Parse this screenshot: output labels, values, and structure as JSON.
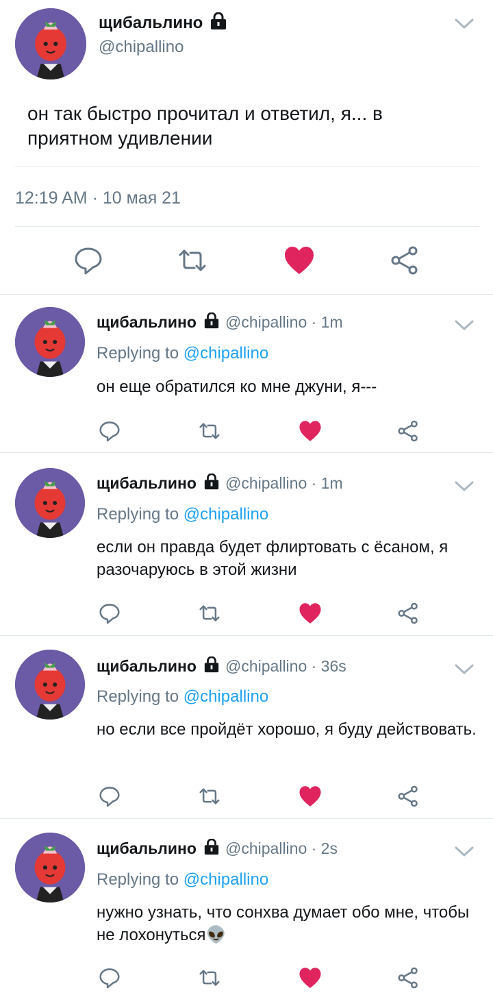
{
  "main_tweet": {
    "display_name": "щибальлино",
    "handle": "@chipallino",
    "text": "он так быстро прочитал и ответил, я... в приятном удивлении",
    "timestamp": "12:19 AM · 10 мая 21"
  },
  "replies": [
    {
      "display_name": "щибальлино",
      "handle_time": "@chipallino · 1m",
      "replying_prefix": "Replying to ",
      "replying_to": "@chipallino",
      "text": "он еще обратился ко мне джуни, я---"
    },
    {
      "display_name": "щибальлино",
      "handle_time": "@chipallino · 1m",
      "replying_prefix": "Replying to ",
      "replying_to": "@chipallino",
      "text": "если он правда будет флиртовать с ёсаном, я разочаруюсь в этой жизни"
    },
    {
      "display_name": "щибальлино",
      "handle_time": "@chipallino · 36s",
      "replying_prefix": "Replying to ",
      "replying_to": "@chipallino",
      "text": "но если все пройдёт хорошо, я буду действовать."
    },
    {
      "display_name": "щибальлино",
      "handle_time": "@chipallino · 2s",
      "replying_prefix": "Replying to ",
      "replying_to": "@chipallino",
      "text": "нужно узнать, что сонхва думает обо мне, чтобы не лохонуться👽"
    }
  ],
  "icons": {
    "reply": "reply-icon",
    "retweet": "retweet-icon",
    "like": "heart-icon",
    "share": "share-icon",
    "lock": "lock-icon",
    "chevron": "chevron-down-icon"
  },
  "colors": {
    "like": "#e0245e",
    "mention": "#1da1f2",
    "secondary_text": "#657786",
    "avatar_bg": "#6b5aa6"
  }
}
